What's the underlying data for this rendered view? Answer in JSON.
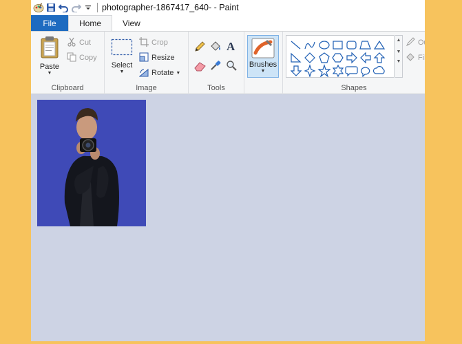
{
  "window": {
    "title": "photographer-1867417_640- - Paint"
  },
  "tabs": {
    "file": "File",
    "home": "Home",
    "view": "View"
  },
  "clipboard": {
    "paste": "Paste",
    "cut": "Cut",
    "copy": "Copy",
    "group_label": "Clipboard"
  },
  "image": {
    "select": "Select",
    "crop": "Crop",
    "resize": "Resize",
    "rotate": "Rotate",
    "group_label": "Image"
  },
  "tools": {
    "group_label": "Tools"
  },
  "brushes": {
    "label": "Brushes"
  },
  "shapes": {
    "outline": "Out",
    "fill": "Fill",
    "group_label": "Shapes",
    "gallery": [
      "line",
      "curve",
      "oval",
      "rectangle",
      "rounded-rectangle",
      "polygon",
      "triangle",
      "right-triangle",
      "diamond",
      "pentagon",
      "hexagon",
      "arrow-right",
      "arrow-left",
      "arrow-up",
      "arrow-down",
      "star-four",
      "star-five",
      "star-six",
      "callout-rounded",
      "callout-oval",
      "callout-cloud"
    ]
  },
  "colors": {
    "background": "#f7c35d",
    "canvas": "#cdd3e4",
    "photo_bg": "#3f4ab7",
    "file_tab": "#1e6bc0",
    "brushes_active": "#cde4f7"
  }
}
